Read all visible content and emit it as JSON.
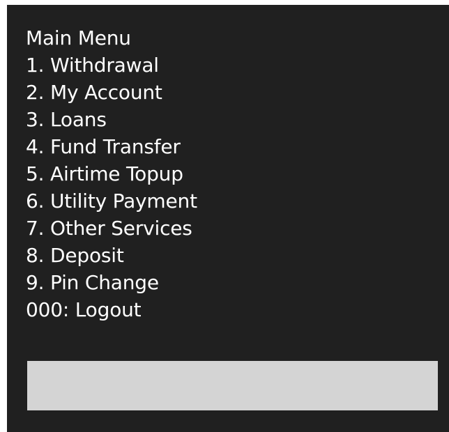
{
  "menu": {
    "title": "Main Menu",
    "items": [
      "1. Withdrawal",
      "2. My Account",
      "3. Loans",
      "4. Fund Transfer",
      "5. Airtime Topup",
      "6. Utility Payment",
      "7. Other Services",
      "8. Deposit",
      "9. Pin Change",
      "000: Logout"
    ]
  },
  "input": {
    "value": "",
    "placeholder": ""
  },
  "colors": {
    "screen_background": "#202020",
    "text": "#ffffff",
    "input_background": "#d4d4d4"
  }
}
